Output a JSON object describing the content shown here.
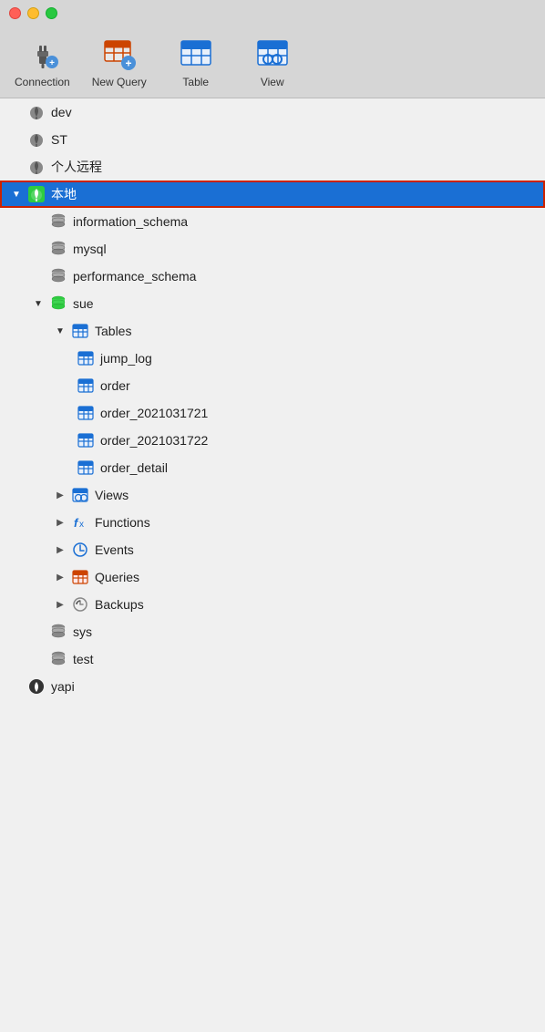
{
  "titlebar": {
    "buttons": [
      "close",
      "minimize",
      "maximize"
    ]
  },
  "toolbar": {
    "items": [
      {
        "id": "connection",
        "label": "Connection",
        "icon": "connection-icon",
        "has_badge": false
      },
      {
        "id": "new-query",
        "label": "New Query",
        "icon": "new-query-icon",
        "has_badge": true
      },
      {
        "id": "table",
        "label": "Table",
        "icon": "table-icon",
        "has_badge": false
      },
      {
        "id": "view",
        "label": "View",
        "icon": "view-icon",
        "has_badge": false
      }
    ]
  },
  "sidebar": {
    "connections": [
      {
        "id": "dev",
        "label": "dev",
        "icon": "leaf-icon",
        "selected": false,
        "level": 1
      },
      {
        "id": "st",
        "label": "ST",
        "icon": "leaf-icon",
        "selected": false,
        "level": 1
      },
      {
        "id": "personal-remote",
        "label": "个人远程",
        "icon": "leaf-icon",
        "selected": false,
        "level": 1
      },
      {
        "id": "local",
        "label": "本地",
        "icon": "leaf-green-icon",
        "selected": true,
        "level": 1,
        "children": [
          {
            "id": "information_schema",
            "label": "information_schema",
            "icon": "db-icon",
            "level": 2
          },
          {
            "id": "mysql",
            "label": "mysql",
            "icon": "db-icon",
            "level": 2
          },
          {
            "id": "performance_schema",
            "label": "performance_schema",
            "icon": "db-icon",
            "level": 2
          },
          {
            "id": "sue",
            "label": "sue",
            "icon": "db-green-icon",
            "level": 2,
            "expanded": true,
            "children": [
              {
                "id": "tables",
                "label": "Tables",
                "icon": "table-icon",
                "level": 3,
                "expanded": true,
                "children": [
                  {
                    "id": "jump_log",
                    "label": "jump_log",
                    "icon": "table-icon",
                    "level": 4
                  },
                  {
                    "id": "order",
                    "label": "order",
                    "icon": "table-icon",
                    "level": 4
                  },
                  {
                    "id": "order_2021031721",
                    "label": "order_2021031721",
                    "icon": "table-icon",
                    "level": 4
                  },
                  {
                    "id": "order_2021031722",
                    "label": "order_2021031722",
                    "icon": "table-icon",
                    "level": 4
                  },
                  {
                    "id": "order_detail",
                    "label": "order_detail",
                    "icon": "table-icon",
                    "level": 4
                  }
                ]
              },
              {
                "id": "views",
                "label": "Views",
                "icon": "views-icon",
                "level": 3
              },
              {
                "id": "functions",
                "label": "Functions",
                "icon": "functions-icon",
                "level": 3
              },
              {
                "id": "events",
                "label": "Events",
                "icon": "events-icon",
                "level": 3
              },
              {
                "id": "queries",
                "label": "Queries",
                "icon": "queries-icon",
                "level": 3
              },
              {
                "id": "backups",
                "label": "Backups",
                "icon": "backups-icon",
                "level": 3
              }
            ]
          },
          {
            "id": "sys",
            "label": "sys",
            "icon": "db-icon",
            "level": 2
          },
          {
            "id": "test",
            "label": "test",
            "icon": "db-icon",
            "level": 2
          }
        ]
      },
      {
        "id": "yapi",
        "label": "yapi",
        "icon": "yapi-icon",
        "selected": false,
        "level": 1
      }
    ]
  }
}
